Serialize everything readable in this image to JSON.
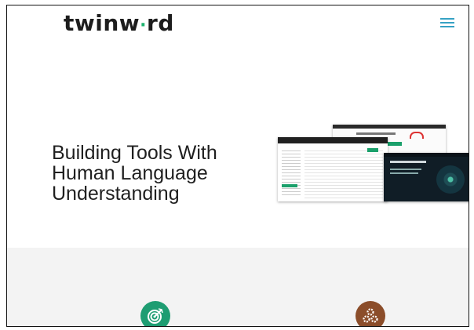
{
  "header": {
    "logo_text_a": "twinw",
    "logo_dot": "·",
    "logo_text_b": "rd",
    "menu_icon": "hamburger-menu-icon"
  },
  "hero": {
    "title_lines": [
      "Building Tools With",
      "Human Language",
      "Understanding"
    ]
  },
  "features": [
    {
      "icon": "target-icon",
      "color": "#1e9d72"
    },
    {
      "icon": "gears-icon",
      "color": "#8b4d2a"
    }
  ],
  "colors": {
    "brand_green": "#1db36f",
    "menu_blue": "#36a2c4"
  }
}
